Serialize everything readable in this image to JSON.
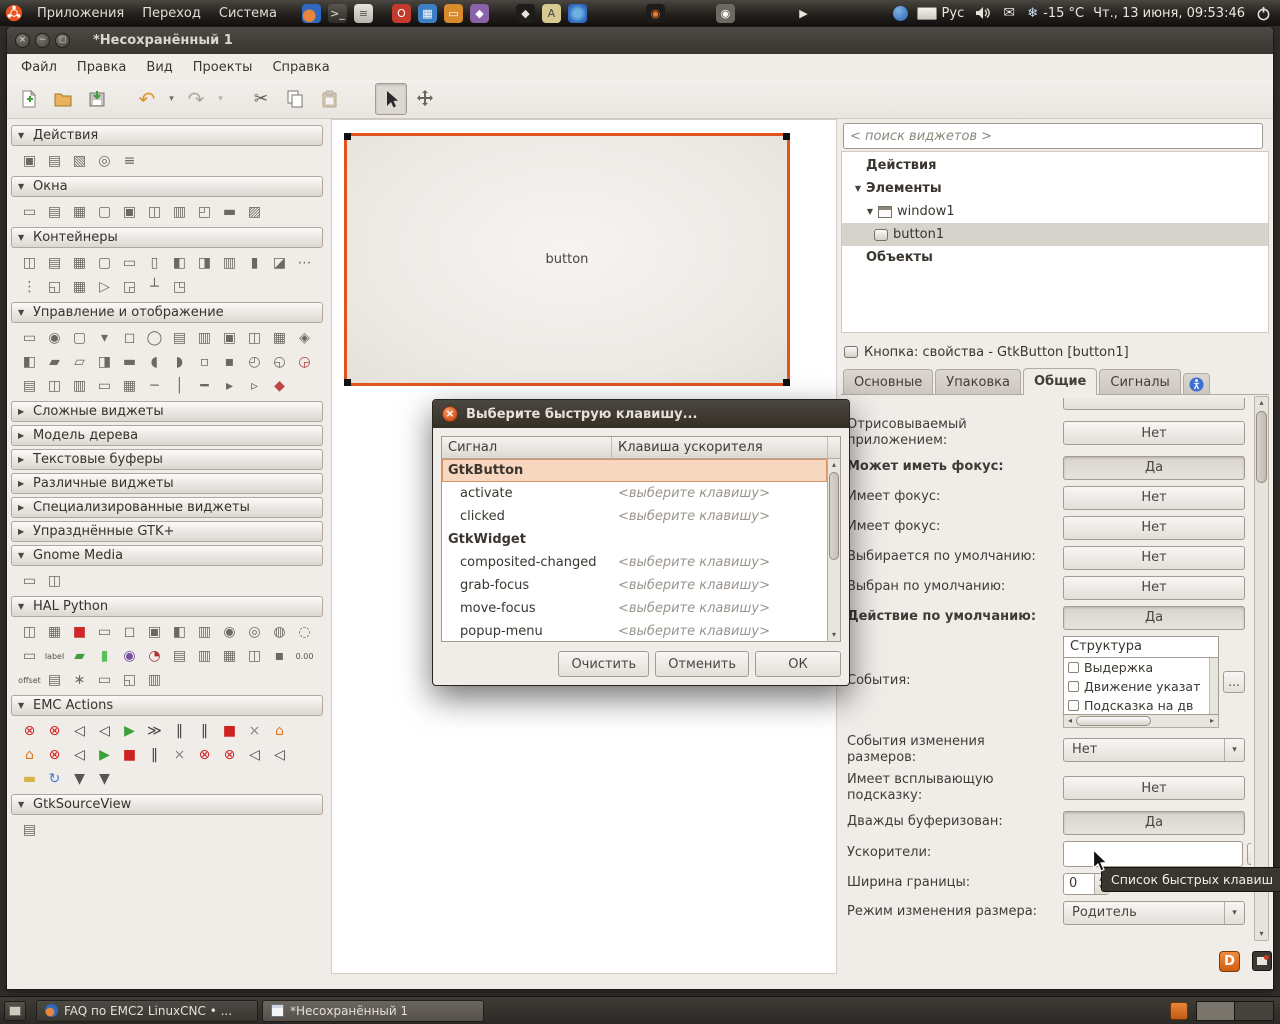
{
  "top_panel": {
    "menus": [
      {
        "name": "applications-menu",
        "label": "Приложения"
      },
      {
        "name": "places-menu",
        "label": "Переход"
      },
      {
        "name": "system-menu",
        "label": "Система"
      }
    ],
    "launchers": [
      {
        "name": "firefox-icon",
        "bg": "radial-gradient(circle at 38% 62%, #e8873c 34%, #2e68c0 42%)"
      },
      {
        "name": "terminal-icon",
        "bg": "linear-gradient(#5a564f,#2e2b27)",
        "glyph": ">_",
        "fg": "#d8e8d0"
      },
      {
        "name": "text-editor-icon",
        "bg": "linear-gradient(#e8e5df,#b8b4ac)",
        "glyph": "≡",
        "fg": "#5a564f"
      },
      {
        "name": "openoffice-writer-icon",
        "bg": "#c23b2e",
        "glyph": "O",
        "fg": "#ffffff",
        "gap": 12
      },
      {
        "name": "openoffice-calc-icon",
        "bg": "#3d7fc4",
        "glyph": "▦",
        "fg": "#ffffff"
      },
      {
        "name": "openoffice-impress-icon",
        "bg": "#d88a2c",
        "glyph": "▭",
        "fg": "#ffffff"
      },
      {
        "name": "openoffice-draw-icon",
        "bg": "#8a62a8",
        "glyph": "◆",
        "fg": "#ffffff"
      },
      {
        "name": "inkscape-icon",
        "bg": "#1e1c1a",
        "glyph": "◆",
        "fg": "#e8e4dc",
        "gap": 20
      },
      {
        "name": "charmap-icon",
        "bg": "#d8c892",
        "glyph": "A",
        "fg": "#4a4640"
      },
      {
        "name": "chromium-icon",
        "bg": "radial-gradient(circle, #6ab0e0 30%, #2e68c0 70%)"
      },
      {
        "name": "blender-icon",
        "bg": "#1e1c1a",
        "glyph": "◉",
        "fg": "#e87d2a",
        "gap": 52
      },
      {
        "name": "gimp-icon",
        "bg": "#6e6a62",
        "glyph": "◉",
        "fg": "#ffffff",
        "gap": 44
      },
      {
        "name": "pointer-launcher-icon",
        "bg": "transparent",
        "glyph": "▶",
        "fg": "#e8e4dc",
        "gap": 52
      }
    ],
    "tray": {
      "keyboard_layout": "Рус",
      "weather_temp": "-15 °C",
      "clock": "Чт., 13 июня, 09:53:46"
    }
  },
  "window": {
    "title": "*Несохранённый 1",
    "menu": [
      {
        "name": "menu-file",
        "label": "Файл"
      },
      {
        "name": "menu-edit",
        "label": "Правка"
      },
      {
        "name": "menu-view",
        "label": "Вид"
      },
      {
        "name": "menu-projects",
        "label": "Проекты"
      },
      {
        "name": "menu-help",
        "label": "Справка"
      }
    ]
  },
  "palette": {
    "sections": [
      {
        "label": "Действия",
        "expanded": true,
        "rows": [
          [
            {
              "g": "▣"
            },
            {
              "g": "▤"
            },
            {
              "g": "▧"
            },
            {
              "g": "◎"
            },
            {
              "g": "≡"
            }
          ]
        ]
      },
      {
        "label": "Окна",
        "expanded": true,
        "rows": [
          [
            {
              "g": "▭"
            },
            {
              "g": "▤"
            },
            {
              "g": "▦"
            },
            {
              "g": "▢"
            },
            {
              "g": "▣"
            },
            {
              "g": "◫"
            },
            {
              "g": "▥"
            },
            {
              "g": "◰"
            },
            {
              "g": "▬"
            },
            {
              "g": "▨"
            }
          ]
        ]
      },
      {
        "label": "Контейнеры",
        "expanded": true,
        "rows": [
          [
            {
              "g": "◫"
            },
            {
              "g": "▤"
            },
            {
              "g": "▦"
            },
            {
              "g": "▢"
            },
            {
              "g": "▭"
            },
            {
              "g": "▯"
            },
            {
              "g": "◧"
            },
            {
              "g": "◨"
            },
            {
              "g": "▥"
            },
            {
              "g": "▮"
            },
            {
              "g": "◪"
            },
            {
              "g": "⋯"
            }
          ],
          [
            {
              "g": "⋮"
            },
            {
              "g": "◱"
            },
            {
              "g": "▦"
            },
            {
              "g": "▷"
            },
            {
              "g": "◲"
            },
            {
              "g": "┴"
            },
            {
              "g": "◳"
            }
          ]
        ]
      },
      {
        "label": "Управление и отображение",
        "expanded": true,
        "rows": [
          [
            {
              "g": "▭"
            },
            {
              "g": "◉"
            },
            {
              "g": "▢"
            },
            {
              "g": "▾"
            },
            {
              "g": "◻"
            },
            {
              "g": "◯"
            },
            {
              "g": "▤"
            },
            {
              "g": "▥"
            },
            {
              "g": "▣"
            },
            {
              "g": "◫"
            },
            {
              "g": "▦"
            },
            {
              "g": "◈"
            }
          ],
          [
            {
              "g": "◧"
            },
            {
              "g": "▰"
            },
            {
              "g": "▱"
            },
            {
              "g": "◨"
            },
            {
              "g": "▬"
            },
            {
              "g": "◖"
            },
            {
              "g": "◗"
            },
            {
              "g": "▫"
            },
            {
              "g": "▪"
            },
            {
              "g": "◴"
            },
            {
              "g": "◵"
            },
            {
              "g": "◶",
              "c": "#b04040"
            }
          ],
          [
            {
              "g": "▤"
            },
            {
              "g": "◫"
            },
            {
              "g": "▥"
            },
            {
              "g": "▭"
            },
            {
              "g": "▦"
            },
            {
              "g": "─"
            },
            {
              "g": "│"
            },
            {
              "g": "━"
            },
            {
              "g": "▸"
            },
            {
              "g": "▹"
            },
            {
              "g": "◆",
              "c": "#c04545"
            }
          ]
        ]
      },
      {
        "label": "Сложные виджеты",
        "expanded": false
      },
      {
        "label": "Модель дерева",
        "expanded": false
      },
      {
        "label": "Текстовые буферы",
        "expanded": false
      },
      {
        "label": "Различные виджеты",
        "expanded": false
      },
      {
        "label": "Специализированные виджеты",
        "expanded": false
      },
      {
        "label": "Упразднённые GTK+",
        "expanded": false
      },
      {
        "label": "Gnome Media",
        "expanded": true,
        "rows": [
          [
            {
              "g": "▭"
            },
            {
              "g": "◫"
            }
          ]
        ]
      },
      {
        "label": "HAL Python",
        "expanded": true,
        "rows": [
          [
            {
              "g": "◫"
            },
            {
              "g": "▦"
            },
            {
              "g": "■",
              "c": "#cc2a2a"
            },
            {
              "g": "▭"
            },
            {
              "g": "◻"
            },
            {
              "g": "▣"
            },
            {
              "g": "◧"
            },
            {
              "g": "▥"
            },
            {
              "g": "◉"
            },
            {
              "g": "◎"
            },
            {
              "g": "◍"
            },
            {
              "g": "◌"
            }
          ],
          [
            {
              "g": "▭"
            },
            {
              "g": "label",
              "txt": true
            },
            {
              "g": "▰",
              "c": "#3f9d3f"
            },
            {
              "g": "▮",
              "c": "#58c058"
            },
            {
              "g": "◉",
              "c": "#7a4fa0"
            },
            {
              "g": "◔",
              "c": "#b03030"
            },
            {
              "g": "▤"
            },
            {
              "g": "▥"
            },
            {
              "g": "▦"
            },
            {
              "g": "◫"
            },
            {
              "g": "▪"
            },
            {
              "g": "0.00",
              "txt": true
            }
          ],
          [
            {
              "g": "offset",
              "txt": true
            },
            {
              "g": "▤"
            },
            {
              "g": "∗"
            },
            {
              "g": "▭"
            },
            {
              "g": "◱"
            },
            {
              "g": "▥"
            }
          ]
        ]
      },
      {
        "label": "EMC Actions",
        "expanded": true,
        "rows": [
          [
            {
              "g": "⊗",
              "c": "#cc2222"
            },
            {
              "g": "⊗",
              "c": "#cc2222"
            },
            {
              "g": "◁",
              "c": "#444444"
            },
            {
              "g": "◁",
              "c": "#444444"
            },
            {
              "g": "▶",
              "c": "#3aa03a"
            },
            {
              "g": "≫",
              "c": "#444444"
            },
            {
              "g": "‖",
              "c": "#444444"
            },
            {
              "g": "‖",
              "c": "#444444"
            },
            {
              "g": "■",
              "c": "#cc2222"
            },
            {
              "g": "×",
              "c": "#888888"
            },
            {
              "g": "⌂",
              "c": "#e07820"
            }
          ],
          [
            {
              "g": "⌂",
              "c": "#e07820"
            },
            {
              "g": "⊗",
              "c": "#cc2222"
            },
            {
              "g": "◁",
              "c": "#444444"
            },
            {
              "g": "▶",
              "c": "#3aa03a"
            },
            {
              "g": "■",
              "c": "#cc2222"
            },
            {
              "g": "‖",
              "c": "#444444"
            },
            {
              "g": "×",
              "c": "#888888"
            },
            {
              "g": "⊗",
              "c": "#cc2222"
            },
            {
              "g": "⊗",
              "c": "#cc2222"
            },
            {
              "g": "◁",
              "c": "#444444"
            },
            {
              "g": "◁",
              "c": "#444444"
            }
          ],
          [
            {
              "g": "▬",
              "c": "#d8b24a"
            },
            {
              "g": "↻",
              "c": "#3a7fd0"
            },
            {
              "g": "▼",
              "c": "#555555"
            },
            {
              "g": "▼",
              "c": "#555555"
            }
          ]
        ]
      },
      {
        "label": "GtkSourceView",
        "expanded": true,
        "rows": [
          [
            {
              "g": "▤"
            }
          ]
        ]
      }
    ]
  },
  "canvas": {
    "button_label": "button"
  },
  "dialog": {
    "title": "Выберите быструю клавишу...",
    "columns": [
      "Сигнал",
      "Клавиша ускорителя"
    ],
    "rows": [
      {
        "signal": "GtkButton",
        "kind": "class",
        "selected": true
      },
      {
        "signal": "activate",
        "kind": "signal",
        "accel_placeholder": "<выберите клавишу>"
      },
      {
        "signal": "clicked",
        "kind": "signal",
        "accel_placeholder": "<выберите клавишу>"
      },
      {
        "signal": "GtkWidget",
        "kind": "class"
      },
      {
        "signal": "composited-changed",
        "kind": "signal",
        "accel_placeholder": "<выберите клавишу>"
      },
      {
        "signal": "grab-focus",
        "kind": "signal",
        "accel_placeholder": "<выберите клавишу>"
      },
      {
        "signal": "move-focus",
        "kind": "signal",
        "accel_placeholder": "<выберите клавишу>"
      },
      {
        "signal": "popup-menu",
        "kind": "signal",
        "accel_placeholder": "<выберите клавишу>"
      }
    ],
    "buttons": [
      {
        "name": "clear-button",
        "label": "Очистить"
      },
      {
        "name": "cancel-button",
        "label": "Отменить"
      },
      {
        "name": "ok-button",
        "label": "ОК"
      }
    ]
  },
  "inspector": {
    "search_placeholder": "< поиск виджетов >",
    "tree": [
      {
        "name": "tree-item-actions",
        "label": "Действия",
        "bold": true,
        "indent": 0
      },
      {
        "name": "tree-item-elements",
        "label": "Элементы",
        "bold": true,
        "indent": 0,
        "expander": "open"
      },
      {
        "name": "tree-item-window1",
        "label": "window1",
        "indent": 1,
        "expander": "open",
        "icon": "window-widget-icon"
      },
      {
        "name": "tree-item-button1",
        "label": "button1",
        "indent": 2,
        "icon": "button-widget-icon",
        "selected": true
      },
      {
        "name": "tree-item-objects",
        "label": "Объекты",
        "bold": true,
        "indent": 0
      }
    ]
  },
  "properties": {
    "header": "Кнопка: свойства - GtkButton [button1]",
    "tabs": [
      {
        "name": "tab-general",
        "label": "Основные"
      },
      {
        "name": "tab-packing",
        "label": "Упаковка"
      },
      {
        "name": "tab-common",
        "label": "Общие",
        "active": true
      },
      {
        "name": "tab-signals",
        "label": "Сигналы"
      }
    ],
    "rows": [
      {
        "label": "Отрисовываемый приложением:",
        "control": {
          "type": "toggle",
          "value": "Нет"
        }
      },
      {
        "label": "Может иметь фокус:",
        "bold": true,
        "control": {
          "type": "toggle",
          "value": "Да",
          "pressed": true
        }
      },
      {
        "label": "Имеет фокус:",
        "control": {
          "type": "toggle",
          "value": "Нет"
        }
      },
      {
        "label": "Имеет фокус:",
        "control": {
          "type": "toggle",
          "value": "Нет"
        }
      },
      {
        "label": "Выбирается по умолчанию:",
        "control": {
          "type": "toggle",
          "value": "Нет"
        }
      },
      {
        "label": "Выбран по умолчанию:",
        "control": {
          "type": "toggle",
          "value": "Нет"
        }
      },
      {
        "label": "Действие по умолчанию:",
        "bold": true,
        "control": {
          "type": "toggle",
          "value": "Да",
          "pressed": true
        }
      },
      {
        "label": "События:",
        "control": {
          "type": "events",
          "selected": "Структура",
          "more_label": "...",
          "options": [
            {
              "label": "Выдержка",
              "checked": false
            },
            {
              "label": "Движение указат",
              "checked": false
            },
            {
              "label": "Подсказка на дв",
              "checked": false
            }
          ]
        }
      },
      {
        "label": "События изменения размеров:",
        "control": {
          "type": "dropdown",
          "value": "Нет"
        }
      },
      {
        "label": "Имеет всплывающую подсказку:",
        "control": {
          "type": "toggle",
          "value": "Нет"
        }
      },
      {
        "label": "Дважды буферизован:",
        "control": {
          "type": "toggle",
          "value": "Да",
          "pressed": true
        }
      },
      {
        "label": "Ускорители:",
        "control": {
          "type": "accel",
          "value": "",
          "more_label": "..."
        }
      },
      {
        "label": "Ширина границы:",
        "control": {
          "type": "spin",
          "value": "0"
        }
      },
      {
        "label": "Режим изменения размера:",
        "control": {
          "type": "dropdown",
          "value": "Родитель"
        }
      }
    ],
    "accel_tooltip": "Список быстрых клавиш"
  },
  "badges": {
    "d_label": "D"
  },
  "taskbar": {
    "items": [
      {
        "name": "taskbar-item-firefox",
        "label": "FAQ по EMC2 LinuxCNC • ...",
        "icon": "firefox-icon"
      },
      {
        "name": "taskbar-item-glade",
        "label": "*Несохранённый 1",
        "icon": "glade-icon",
        "active": true
      }
    ]
  }
}
